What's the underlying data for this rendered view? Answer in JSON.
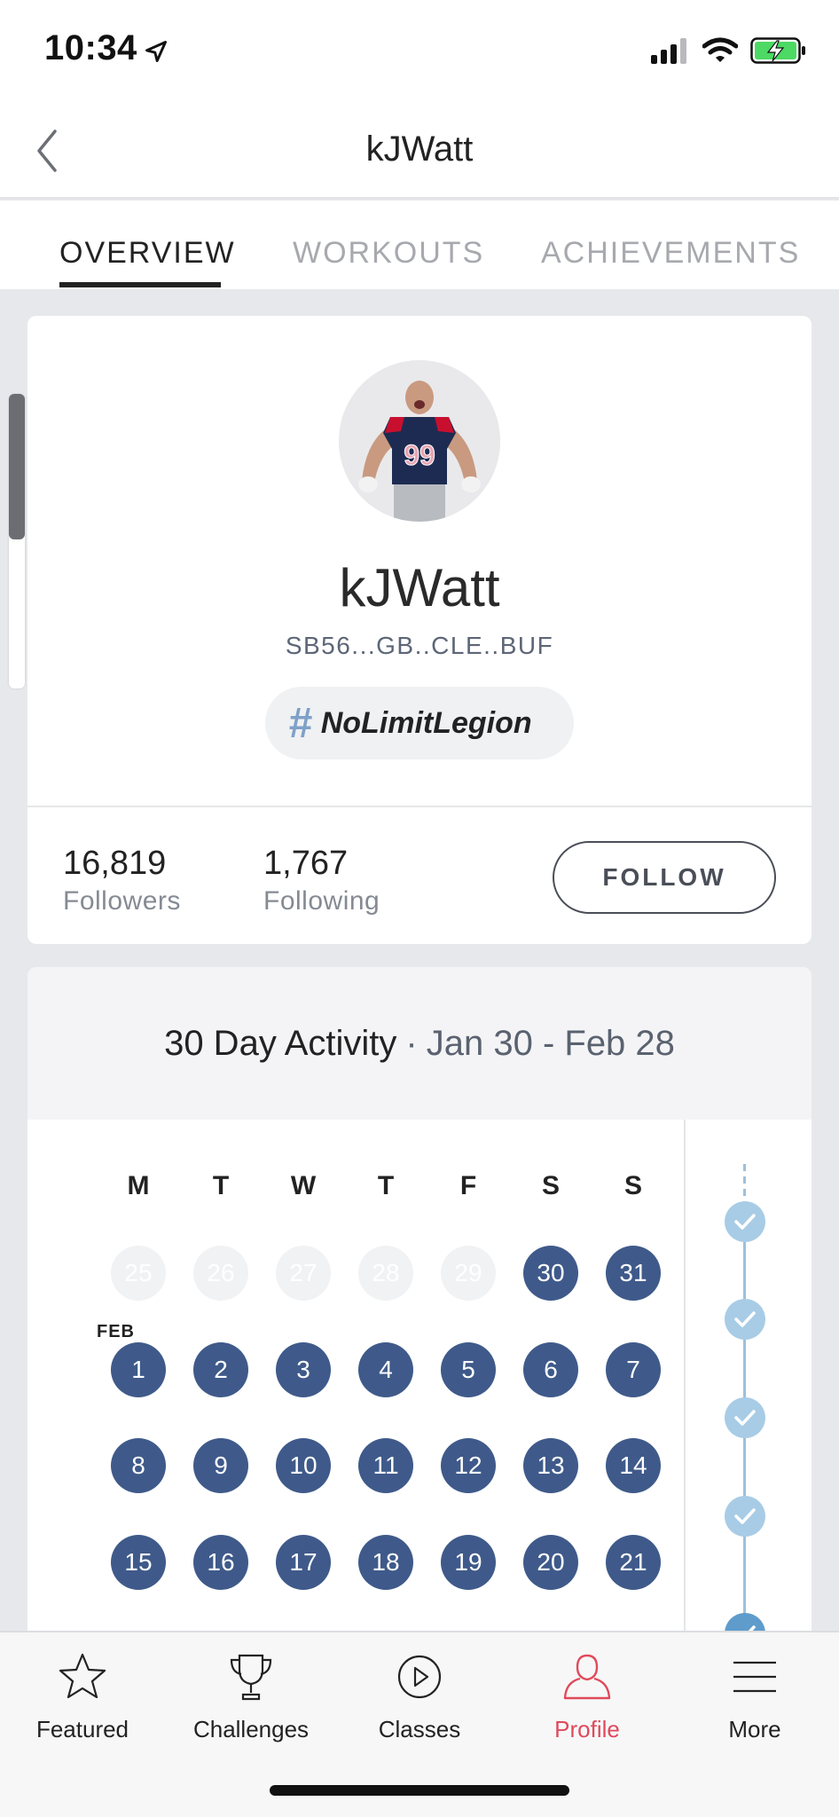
{
  "status": {
    "time": "10:34"
  },
  "nav": {
    "title": "kJWatt"
  },
  "tabs": [
    {
      "label": "OVERVIEW",
      "active": true
    },
    {
      "label": "WORKOUTS",
      "active": false
    },
    {
      "label": "ACHIEVEMENTS",
      "active": false
    }
  ],
  "profile": {
    "username": "kJWatt",
    "handle": "SB56...GB..CLE..BUF",
    "tag": "NoLimitLegion",
    "followers_count": "16,819",
    "followers_label": "Followers",
    "following_count": "1,767",
    "following_label": "Following",
    "follow_button": "FOLLOW"
  },
  "activity": {
    "title": "30 Day Activity",
    "separator": "·",
    "range": "Jan 30 - Feb 28",
    "weekdays": [
      "M",
      "T",
      "W",
      "T",
      "F",
      "S",
      "S"
    ],
    "month_label": "FEB",
    "weeks": [
      [
        {
          "d": "25",
          "active": false
        },
        {
          "d": "26",
          "active": false
        },
        {
          "d": "27",
          "active": false
        },
        {
          "d": "28",
          "active": false
        },
        {
          "d": "29",
          "active": false
        },
        {
          "d": "30",
          "active": true
        },
        {
          "d": "31",
          "active": true
        }
      ],
      [
        {
          "d": "1",
          "active": true
        },
        {
          "d": "2",
          "active": true
        },
        {
          "d": "3",
          "active": true
        },
        {
          "d": "4",
          "active": true
        },
        {
          "d": "5",
          "active": true
        },
        {
          "d": "6",
          "active": true
        },
        {
          "d": "7",
          "active": true
        }
      ],
      [
        {
          "d": "8",
          "active": true
        },
        {
          "d": "9",
          "active": true
        },
        {
          "d": "10",
          "active": true
        },
        {
          "d": "11",
          "active": true
        },
        {
          "d": "12",
          "active": true
        },
        {
          "d": "13",
          "active": true
        },
        {
          "d": "14",
          "active": true
        }
      ],
      [
        {
          "d": "15",
          "active": true
        },
        {
          "d": "16",
          "active": true
        },
        {
          "d": "17",
          "active": true
        },
        {
          "d": "18",
          "active": true
        },
        {
          "d": "19",
          "active": true
        },
        {
          "d": "20",
          "active": true
        },
        {
          "d": "21",
          "active": true
        }
      ]
    ]
  },
  "tabbar": [
    {
      "label": "Featured",
      "icon": "star-icon",
      "active": false
    },
    {
      "label": "Challenges",
      "icon": "trophy-icon",
      "active": false
    },
    {
      "label": "Classes",
      "icon": "play-circle-icon",
      "active": false
    },
    {
      "label": "Profile",
      "icon": "person-icon",
      "active": true
    },
    {
      "label": "More",
      "icon": "menu-icon",
      "active": false
    }
  ],
  "colors": {
    "accent_active": "#e04a5b",
    "calendar_active": "#3f5a8a",
    "check": "#a8cce6"
  }
}
